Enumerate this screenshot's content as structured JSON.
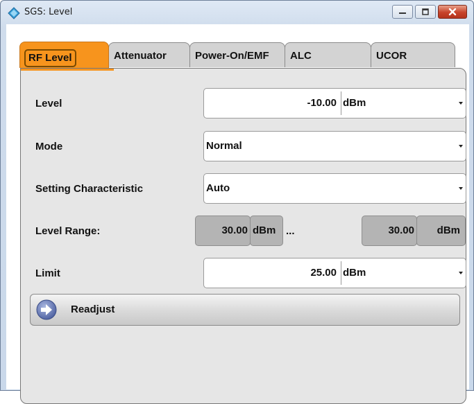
{
  "window": {
    "title": "SGS: Level",
    "icon": "diamond-app-icon",
    "buttons": [
      "minimize-icon",
      "maximize-icon",
      "close-icon"
    ]
  },
  "tabs": [
    {
      "label": "RF Level",
      "active": true
    },
    {
      "label": "Attenuator",
      "active": false
    },
    {
      "label": "Power-On/EMF",
      "active": false
    },
    {
      "label": "ALC",
      "active": false
    },
    {
      "label": "UCOR",
      "active": false
    }
  ],
  "fields": {
    "level": {
      "label": "Level",
      "value": "-10.00",
      "unit": "dBm"
    },
    "mode": {
      "label": "Mode",
      "value": "Normal"
    },
    "setting_characteristic": {
      "label": "Setting Characteristic",
      "value": "Auto"
    },
    "level_range": {
      "label": "Level Range:",
      "min_value": "30.00",
      "min_unit": "dBm",
      "separator": "...",
      "max_value": "30.00",
      "max_unit": "dBm"
    },
    "limit": {
      "label": "Limit",
      "value": "25.00",
      "unit": "dBm"
    }
  },
  "readjust": {
    "label": "Readjust",
    "icon": "arrow-right-circle-icon"
  },
  "colors": {
    "active_tab": "#f7941d",
    "panel_bg": "#e6e6e6",
    "readonly_bg": "#b4b4b4"
  }
}
